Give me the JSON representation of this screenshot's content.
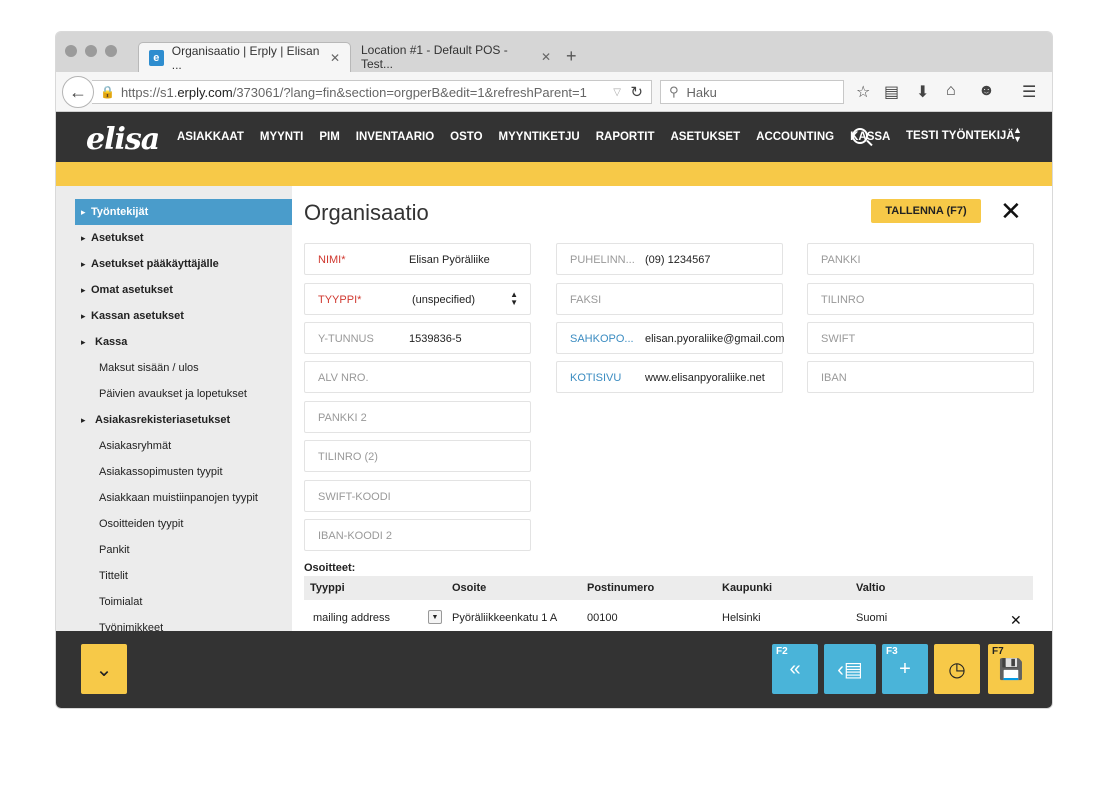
{
  "browser": {
    "tabs": [
      {
        "title": "Organisaatio | Erply | Elisan ...",
        "favicon": "e"
      },
      {
        "title": "Location #1 - Default POS - Test..."
      }
    ],
    "url": {
      "prefix": "https://s1.",
      "domain": "erply.com",
      "path": "/373061/?lang=fin&section=orgperB&edit=1&refreshParent=1"
    },
    "search_placeholder": "Haku"
  },
  "app": {
    "logo": "elisa",
    "menu": [
      "ASIAKKAAT",
      "MYYNTI",
      "PIM",
      "INVENTAARIO",
      "OSTO",
      "MYYNTIKETJU",
      "RAPORTIT",
      "ASETUKSET",
      "ACCOUNTING",
      "KASSA"
    ],
    "user": "TESTI TYÖNTEKIJÄ"
  },
  "sidebar": {
    "items": [
      {
        "label": "Työntekijät",
        "bold": true,
        "active": true
      },
      {
        "label": "Asetukset",
        "bold": true
      },
      {
        "label": "Asetukset pääkäyttäjälle",
        "bold": true
      },
      {
        "label": "Omat asetukset",
        "bold": true
      },
      {
        "label": "Kassan asetukset",
        "bold": true
      },
      {
        "label": "Kassa",
        "bold": true
      },
      {
        "label": "Maksut sisään / ulos"
      },
      {
        "label": "Päivien avaukset ja lopetukset"
      },
      {
        "label": "Asiakasrekisteriasetukset",
        "bold": true
      },
      {
        "label": "Asiakasryhmät"
      },
      {
        "label": "Asiakassopimusten tyypit"
      },
      {
        "label": "Asiakkaan muistiinpanojen tyypit"
      },
      {
        "label": "Osoitteiden tyypit"
      },
      {
        "label": "Pankit"
      },
      {
        "label": "Tittelit"
      },
      {
        "label": "Toimialat"
      },
      {
        "label": "Työnimikkeet"
      }
    ]
  },
  "page": {
    "title": "Organisaatio",
    "save_label": "TALLENNA (F7)"
  },
  "form": {
    "col1": [
      {
        "label": "NIMI*",
        "value": "Elisan Pyöräliike"
      },
      {
        "label": "TYYPPI*",
        "value": "(unspecified)"
      },
      {
        "label": "Y-TUNNUS",
        "value": "1539836-5"
      },
      {
        "label": "ALV NRO.",
        "value": ""
      },
      {
        "label": "PANKKI 2",
        "value": ""
      },
      {
        "label": "TILINRO (2)",
        "value": ""
      },
      {
        "label": "SWIFT-KOODI",
        "value": ""
      },
      {
        "label": "IBAN-KOODI 2",
        "value": ""
      }
    ],
    "col2": [
      {
        "label": "PUHELINN...",
        "value": "(09) 1234567"
      },
      {
        "label": "FAKSI",
        "value": ""
      },
      {
        "label": "SAHKOPO...",
        "value": "elisan.pyoraliike@gmail.com"
      },
      {
        "label": "KOTISIVU",
        "value": "www.elisanpyoraliike.net"
      }
    ],
    "col3": [
      {
        "label": "PANKKI"
      },
      {
        "label": "TILINRO"
      },
      {
        "label": "SWIFT"
      },
      {
        "label": "IBAN"
      }
    ]
  },
  "addresses": {
    "title": "Osoitteet:",
    "headers": [
      "Tyyppi",
      "Osoite",
      "Postinumero",
      "Kaupunki",
      "Valtio"
    ],
    "rows": [
      {
        "type": "mailing address",
        "address": "Pyöräliikkeenkatu 1 A",
        "postal": "00100",
        "city": "Helsinki",
        "country": "Suomi"
      }
    ]
  },
  "footer": {
    "keys": {
      "back": "F2",
      "add": "F3",
      "save": "F7"
    }
  },
  "colors": {
    "accent": "#f7c948",
    "nav": "#333333",
    "active": "#4a9ccb",
    "button_blue": "#4ab4d9",
    "required": "#d0382f"
  }
}
